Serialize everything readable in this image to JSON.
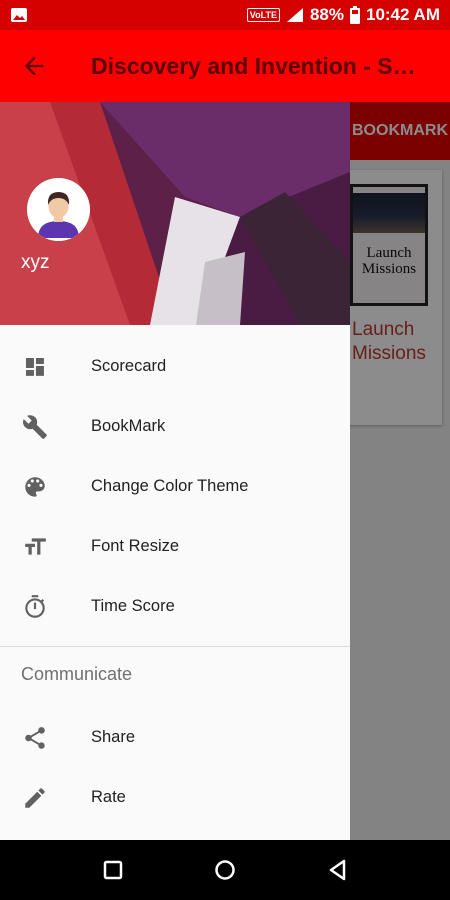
{
  "status_bar": {
    "network_label": "VoLTE",
    "battery_percent": "88%",
    "time": "10:42 AM",
    "icons": [
      "image-icon",
      "volte-badge",
      "signal-icon",
      "battery-icon"
    ]
  },
  "app_bar": {
    "title": "Discovery and Invention - S…",
    "back_icon": "arrow-back-icon"
  },
  "background": {
    "tab_label": "BOOKMARK",
    "card_image_text": "Launch Missions",
    "card_title": "Launch Missions"
  },
  "drawer": {
    "user_name": "xyz",
    "items": [
      {
        "label": "Scorecard",
        "icon": "dashboard-icon"
      },
      {
        "label": "BookMark",
        "icon": "wrench-icon"
      },
      {
        "label": "Change Color Theme",
        "icon": "palette-icon"
      },
      {
        "label": "Font Resize",
        "icon": "text-size-icon"
      },
      {
        "label": "Time Score",
        "icon": "timer-icon"
      }
    ],
    "section_title": "Communicate",
    "communicate_items": [
      {
        "label": "Share",
        "icon": "share-icon"
      },
      {
        "label": "Rate",
        "icon": "pencil-icon"
      }
    ]
  },
  "nav_bar": {
    "buttons": [
      "recent-apps-icon",
      "home-icon",
      "back-triangle-icon"
    ]
  },
  "colors": {
    "status_bar": "#d50000",
    "app_bar": "#ff0000",
    "title_text": "#5a0000",
    "icon_gray": "#616161"
  }
}
